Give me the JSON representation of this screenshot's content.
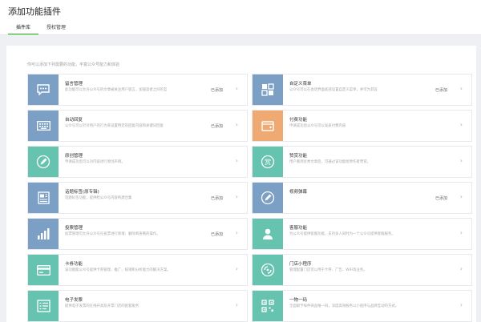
{
  "page": {
    "title": "添加功能插件"
  },
  "tabs": [
    {
      "label": "插件库",
      "active": true
    },
    {
      "label": "授权管理",
      "active": false
    }
  ],
  "intro": "你可以添加下列需要的功能，丰富公众号能力和体验",
  "colors": {
    "accent": "#1aad19",
    "blue": "#7b9fc5",
    "teal": "#65c3b0",
    "orange": "#efaa73"
  },
  "cards": [
    {
      "icon": "message-icon",
      "color": "blue",
      "title": "留言管理",
      "desc": "此功能可以允许公众号的文章被关注用户留言，加强读者之间的互",
      "status": "已添加"
    },
    {
      "icon": "menu-icon",
      "color": "blue",
      "title": "自定义菜单",
      "desc": "公众号可以在会话界面底部设置自定义菜单，并可为其设",
      "status": "已添加"
    },
    {
      "icon": "keyboard-icon",
      "color": "blue",
      "title": "自动回复",
      "desc": "公众号可以针对用户的行为来设置特定的回复内容和关键词回复",
      "status": "已添加"
    },
    {
      "icon": "wallet-icon",
      "color": "orange",
      "title": "付费功能",
      "desc": "申请成功后公众号可以发表付费内容",
      "status": ""
    },
    {
      "icon": "pen-icon",
      "color": "teal",
      "title": "原创管理",
      "desc": "申请成功后可以对内容进行原创声明。",
      "status": ""
    },
    {
      "icon": "reward-icon",
      "color": "teal",
      "title": "赞赏功能",
      "desc": "用户看到优秀文章后，可通过该功能给原作者赞赏。",
      "status": ""
    },
    {
      "icon": "newspaper-icon",
      "color": "blue",
      "title": "话题标签(原专辑)",
      "desc": "话题标签功能，提供给公众号内容构建合集",
      "status": "已添加"
    },
    {
      "icon": "pen-icon",
      "color": "blue",
      "title": "视频弹幕",
      "desc": "",
      "status": "已添加"
    },
    {
      "icon": "chart-icon",
      "color": "blue",
      "title": "投票管理",
      "desc": "投票管理可允许公众号在投票进行新增、删除和查看的操作。",
      "status": "已添加"
    },
    {
      "icon": "person-icon",
      "color": "teal",
      "title": "客服功能",
      "desc": "为公众号提供客服功能，支持多人同时为一个公众号提供客服服务。",
      "status": ""
    },
    {
      "icon": "card-icon",
      "color": "teal",
      "title": "卡券功能",
      "desc": "该功能能公众号提供卡券管理、推广、核销和分析能力的解决方案。",
      "status": ""
    },
    {
      "icon": "store-icon",
      "color": "teal",
      "title": "门店小程序",
      "desc": "管理配置门店可以用于卡券、广告、WiFi等业务。",
      "status": ""
    },
    {
      "icon": "invoice-icon",
      "color": "teal",
      "title": "电子发票",
      "desc": "提供电子发票的在线开具及开票门店的配套服务",
      "status": ""
    },
    {
      "icon": "qrcode-icon",
      "color": "teal",
      "title": "一物一码",
      "desc": "全面赋予每件商品唯一码，深度高效服务以小程序与品牌互动的方式。",
      "status": ""
    }
  ],
  "chevron": "›"
}
